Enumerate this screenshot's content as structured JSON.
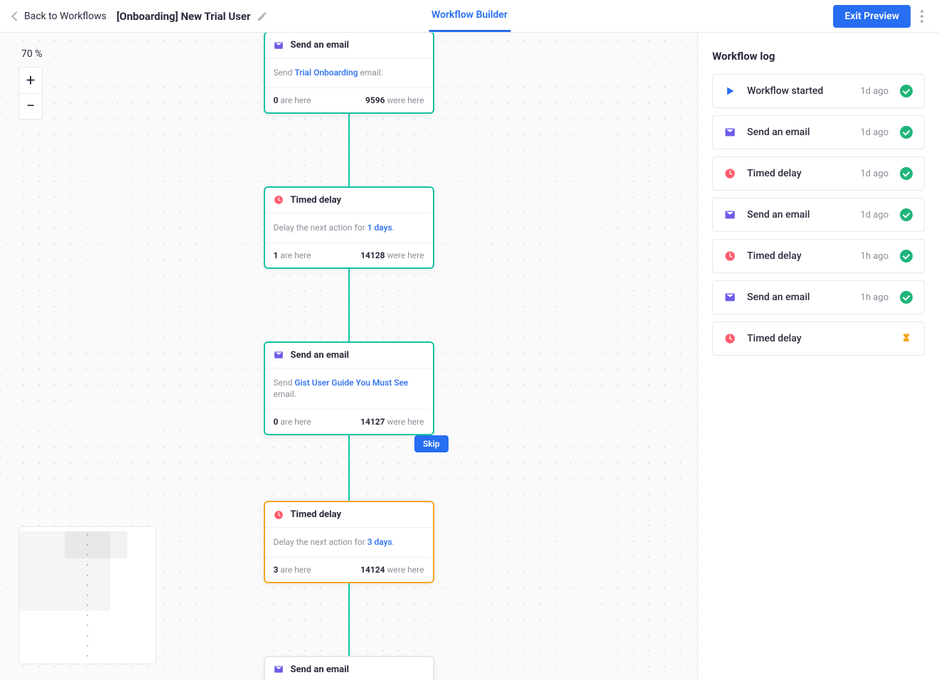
{
  "header": {
    "back_label": "Back to Workflows",
    "workflow_title": "[Onboarding] New Trial User",
    "tab_label": "Workflow Builder",
    "exit_preview_label": "Exit Preview"
  },
  "zoom": {
    "level_label": "70 %",
    "plus": "+",
    "minus": "−"
  },
  "nodes": [
    {
      "type": "email",
      "title": "Send an email",
      "body_prefix": "Send ",
      "body_link": "Trial Onboarding",
      "body_suffix": " email.",
      "are_here_count": "0",
      "are_here_label": " are here",
      "were_here_count": "9596",
      "were_here_label": " were here",
      "border": "teal"
    },
    {
      "type": "delay",
      "title": "Timed delay",
      "body_prefix": "Delay the next action for ",
      "body_link": "1 days",
      "body_suffix": ".",
      "are_here_count": "1",
      "are_here_label": " are here",
      "were_here_count": "14128",
      "were_here_label": " were here",
      "border": "teal"
    },
    {
      "type": "email",
      "title": "Send an email",
      "body_prefix": "Send ",
      "body_link": "Gist User Guide You Must See",
      "body_suffix": " email.",
      "are_here_count": "0",
      "are_here_label": " are here",
      "were_here_count": "14127",
      "were_here_label": " were here",
      "border": "teal"
    },
    {
      "type": "delay",
      "title": "Timed delay",
      "body_prefix": "Delay the next action for ",
      "body_link": "3 days",
      "body_suffix": ".",
      "are_here_count": "3",
      "are_here_label": " are here",
      "were_here_count": "14124",
      "were_here_label": " were here",
      "border": "amber",
      "skip_label": "Skip"
    },
    {
      "type": "email",
      "title": "Send an email",
      "partial": true
    }
  ],
  "log": {
    "title": "Workflow log",
    "items": [
      {
        "icon": "play",
        "color": "#276ef1",
        "label": "Workflow started",
        "time": "1d ago",
        "status": "ok"
      },
      {
        "icon": "mail",
        "color": "#6b5ce7",
        "label": "Send an email",
        "time": "1d ago",
        "status": "ok"
      },
      {
        "icon": "clock",
        "color": "#ff5c6c",
        "label": "Timed delay",
        "time": "1d ago",
        "status": "ok"
      },
      {
        "icon": "mail",
        "color": "#6b5ce7",
        "label": "Send an email",
        "time": "1d ago",
        "status": "ok"
      },
      {
        "icon": "clock",
        "color": "#ff5c6c",
        "label": "Timed delay",
        "time": "1h ago",
        "status": "ok"
      },
      {
        "icon": "mail",
        "color": "#6b5ce7",
        "label": "Send an email",
        "time": "1h ago",
        "status": "ok"
      },
      {
        "icon": "clock",
        "color": "#ff5c6c",
        "label": "Timed delay",
        "time": "",
        "status": "wait"
      }
    ]
  }
}
